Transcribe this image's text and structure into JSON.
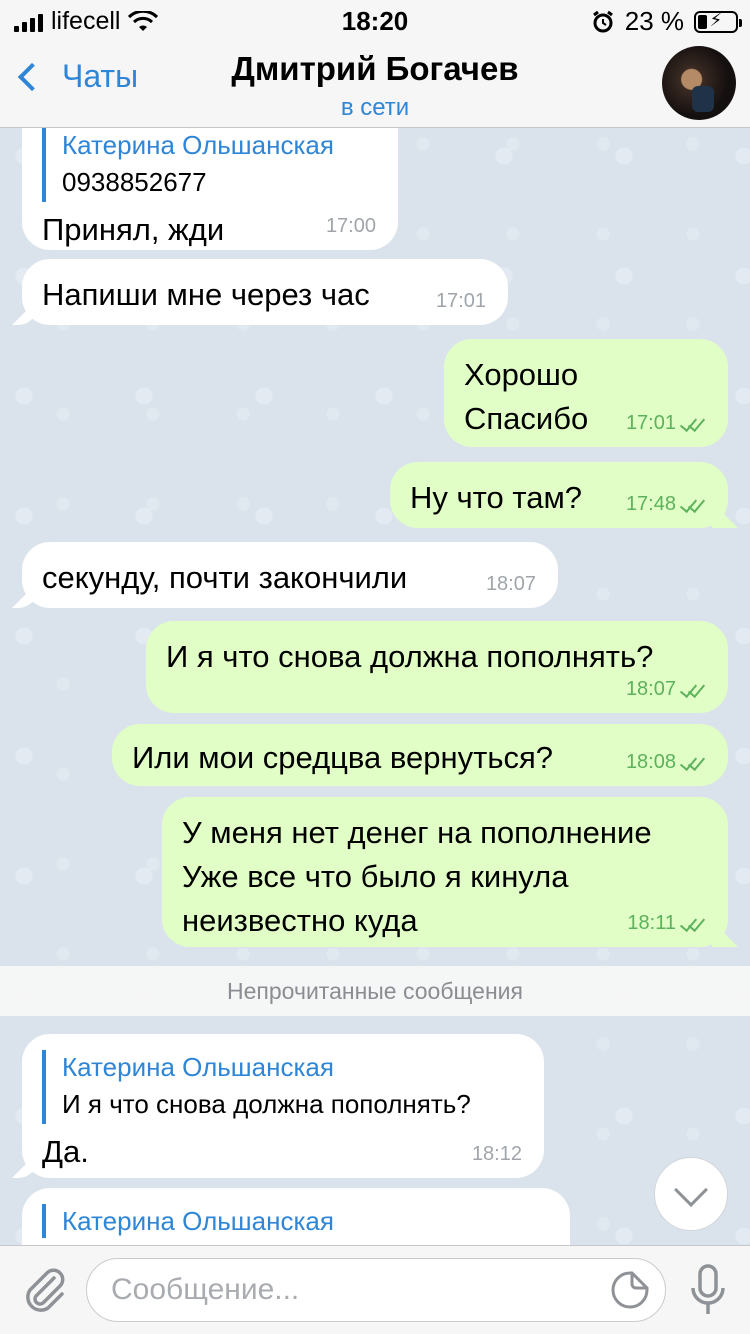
{
  "status_bar": {
    "carrier": "lifecell",
    "time": "18:20",
    "battery": "23 %",
    "battery_level": 0.23
  },
  "header": {
    "back_label": "Чаты",
    "title": "Дмитрий Богачев",
    "subtitle": "в сети"
  },
  "messages": [
    {
      "dir": "in",
      "reply_name": "Катерина Ольшанская",
      "reply_text": "0938852677",
      "text": "Принял, жди",
      "time": "17:00"
    },
    {
      "dir": "in",
      "text": "Напиши мне через час",
      "time": "17:01"
    },
    {
      "dir": "out",
      "text": "Хорошо\nСпасибо",
      "time": "17:01"
    },
    {
      "dir": "out",
      "text": "Ну что там?",
      "time": "17:48"
    },
    {
      "dir": "in",
      "text": "секунду, почти закончили",
      "time": "18:07"
    },
    {
      "dir": "out",
      "text": "И я что снова должна пополнять?",
      "time": "18:07"
    },
    {
      "dir": "out",
      "text": "Или мои средцва вернуться?",
      "time": "18:08"
    },
    {
      "dir": "out",
      "text": "У меня нет денег на пополнение\nУже все что было я кинула\nнеизвестно куда",
      "time": "18:11"
    },
    {
      "dir": "in",
      "reply_name": "Катерина Ольшанская",
      "reply_text": "И я что снова должна пополнять?",
      "text": "Да.",
      "time": "18:12"
    },
    {
      "dir": "in",
      "reply_name": "Катерина Ольшанская"
    }
  ],
  "unread_label": "Непрочитанные сообщения",
  "composer": {
    "placeholder": "Сообщение..."
  },
  "colors": {
    "accent": "#2f86d6",
    "outgoing_bubble": "#e1fec6",
    "incoming_bubble": "#ffffff",
    "time_out": "#5cb25c"
  },
  "icons": [
    "signal-icon",
    "wifi-icon",
    "alarm-icon",
    "battery-icon",
    "back-chevron-icon",
    "attach-icon",
    "sticker-icon",
    "mic-icon",
    "scroll-down-icon",
    "double-check-icon"
  ]
}
